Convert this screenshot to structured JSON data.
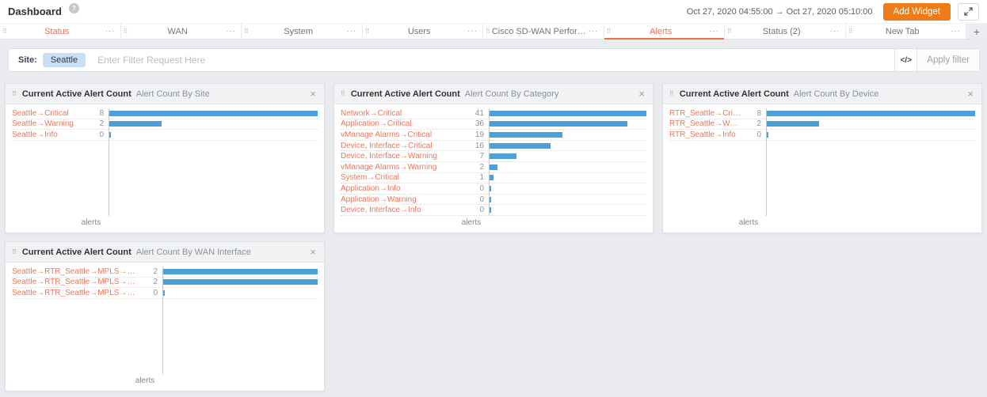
{
  "header": {
    "title": "Dashboard",
    "date_range": "Oct 27, 2020 04:55:00 → Oct 27, 2020 05:10:00",
    "add_widget_label": "Add Widget"
  },
  "icons": {
    "help": "?",
    "drag_handle": "⠿",
    "menu": "···",
    "close": "×",
    "code": "</>",
    "add_tab": "+"
  },
  "tabs": [
    {
      "label": "Status",
      "highlighted": true
    },
    {
      "label": "WAN"
    },
    {
      "label": "System"
    },
    {
      "label": "Users"
    },
    {
      "label": "Cisco SD-WAN Performance"
    },
    {
      "label": "Alerts",
      "active": true
    },
    {
      "label": "Status (2)"
    },
    {
      "label": "New Tab"
    }
  ],
  "filter_bar": {
    "site_label": "Site:",
    "site_value": "Seattle",
    "placeholder": "Enter Filter Request Here",
    "apply_label": "Apply filter"
  },
  "widgets": [
    {
      "title": "Current Active Alert Count",
      "subtitle": "Alert Count By Site",
      "xlabel": "alerts",
      "rows": [
        {
          "label": "Seattle→Critical",
          "value": 8
        },
        {
          "label": "Seattle→Warning",
          "value": 2
        },
        {
          "label": "Seattle→Info",
          "value": 0
        }
      ]
    },
    {
      "title": "Current Active Alert Count",
      "subtitle": "Alert Count By Category",
      "xlabel": "alerts",
      "rows": [
        {
          "label": "Network→Critical",
          "value": 41
        },
        {
          "label": "Application→Critical",
          "value": 36
        },
        {
          "label": "vManage Alarms→Critical",
          "value": 19
        },
        {
          "label": "Device, Interface→Critical",
          "value": 16
        },
        {
          "label": "Device, Interface→Warning",
          "value": 7
        },
        {
          "label": "vManage Alarms→Warning",
          "value": 2
        },
        {
          "label": "System→Critical",
          "value": 1
        },
        {
          "label": "Application→Info",
          "value": 0
        },
        {
          "label": "Application→Warning",
          "value": 0
        },
        {
          "label": "Device, Interface→Info",
          "value": 0
        }
      ]
    },
    {
      "title": "Current Active Alert Count",
      "subtitle": "Alert Count By Device",
      "xlabel": "alerts",
      "rows": [
        {
          "label": "RTR_Seattle→Critical",
          "value": 8
        },
        {
          "label": "RTR_Seattle→Warning",
          "value": 2
        },
        {
          "label": "RTR_Seattle→Info",
          "value": 0
        }
      ]
    },
    {
      "title": "Current Active Alert Count",
      "subtitle": "Alert Count By WAN Interface",
      "xlabel": "alerts",
      "rows": [
        {
          "label": "Seattle→RTR_Seattle→MPLS→GigabitEt...",
          "value": 2
        },
        {
          "label": "Seattle→RTR_Seattle→MPLS→GigabitEt...",
          "value": 2
        },
        {
          "label": "Seattle→RTR_Seattle→MPLS→GigabitEt...",
          "value": 0
        }
      ]
    }
  ],
  "chart_data": [
    {
      "type": "bar",
      "orientation": "horizontal",
      "title": "Current Active Alert Count",
      "subtitle": "Alert Count By Site",
      "categories": [
        "Seattle→Critical",
        "Seattle→Warning",
        "Seattle→Info"
      ],
      "values": [
        8,
        2,
        0
      ],
      "xlabel": "alerts",
      "xlim": [
        0,
        8
      ],
      "bar_color": "#4d9fd7"
    },
    {
      "type": "bar",
      "orientation": "horizontal",
      "title": "Current Active Alert Count",
      "subtitle": "Alert Count By Category",
      "categories": [
        "Network→Critical",
        "Application→Critical",
        "vManage Alarms→Critical",
        "Device, Interface→Critical",
        "Device, Interface→Warning",
        "vManage Alarms→Warning",
        "System→Critical",
        "Application→Info",
        "Application→Warning",
        "Device, Interface→Info"
      ],
      "values": [
        41,
        36,
        19,
        16,
        7,
        2,
        1,
        0,
        0,
        0
      ],
      "xlabel": "alerts",
      "xlim": [
        0,
        41
      ],
      "bar_color": "#4d9fd7"
    },
    {
      "type": "bar",
      "orientation": "horizontal",
      "title": "Current Active Alert Count",
      "subtitle": "Alert Count By Device",
      "categories": [
        "RTR_Seattle→Critical",
        "RTR_Seattle→Warning",
        "RTR_Seattle→Info"
      ],
      "values": [
        8,
        2,
        0
      ],
      "xlabel": "alerts",
      "xlim": [
        0,
        8
      ],
      "bar_color": "#4d9fd7"
    },
    {
      "type": "bar",
      "orientation": "horizontal",
      "title": "Current Active Alert Count",
      "subtitle": "Alert Count By WAN Interface",
      "categories": [
        "Seattle→RTR_Seattle→MPLS→GigabitEt...",
        "Seattle→RTR_Seattle→MPLS→GigabitEt...",
        "Seattle→RTR_Seattle→MPLS→GigabitEt..."
      ],
      "values": [
        2,
        2,
        0
      ],
      "xlabel": "alerts",
      "xlim": [
        0,
        2
      ],
      "bar_color": "#4d9fd7"
    }
  ],
  "colors": {
    "accent_orange": "#ee7b17",
    "tab_active": "#e8735a",
    "tab_underline": "#ee7442",
    "bar_blue": "#4d9fd7",
    "row_label": "#e8785c",
    "chip_bg": "#c9dff4",
    "page_bg": "#e9ebee"
  }
}
